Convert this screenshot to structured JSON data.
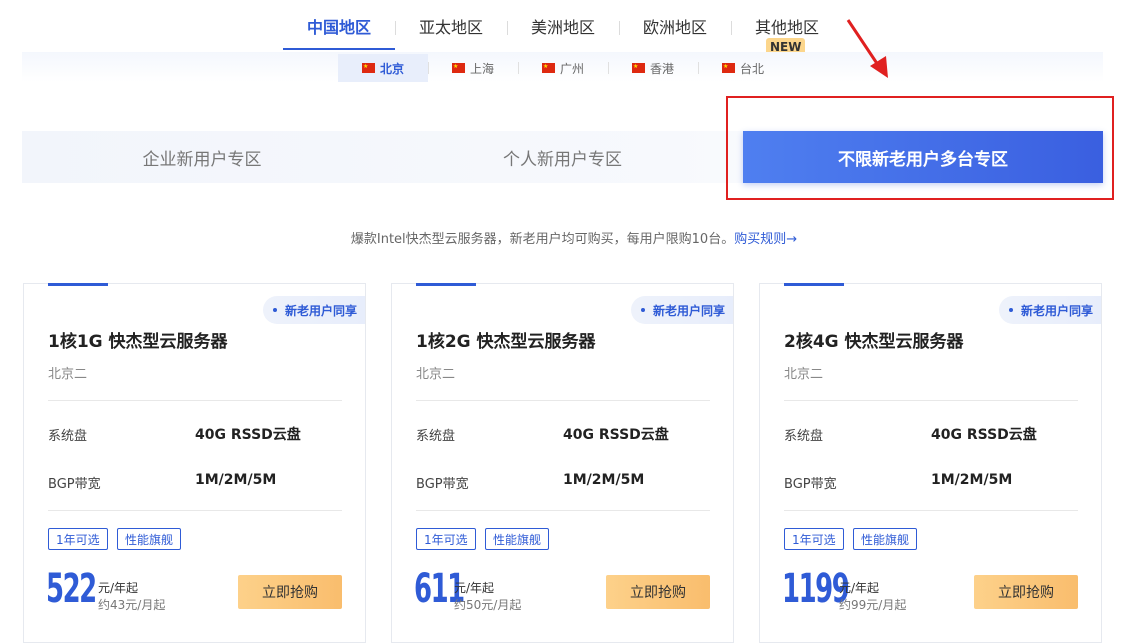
{
  "regions": [
    {
      "label": "中国地区",
      "active": true
    },
    {
      "label": "亚太地区",
      "active": false
    },
    {
      "label": "美洲地区",
      "active": false
    },
    {
      "label": "欧洲地区",
      "active": false
    },
    {
      "label": "其他地区",
      "active": false
    }
  ],
  "new_badge": "NEW",
  "cities": [
    {
      "label": "北京",
      "active": true
    },
    {
      "label": "上海",
      "active": false
    },
    {
      "label": "广州",
      "active": false
    },
    {
      "label": "香港",
      "active": false
    },
    {
      "label": "台北",
      "active": false
    }
  ],
  "zones": [
    {
      "label": "企业新用户专区",
      "active": false
    },
    {
      "label": "个人新用户专区",
      "active": false
    },
    {
      "label": "不限新老用户多台专区",
      "active": true
    }
  ],
  "notice": {
    "text": "爆款Intel快杰型云服务器，新老用户均可购买，每用户限购10台。",
    "link": "购买规则→"
  },
  "cards": [
    {
      "badge": "新老用户同享",
      "title": "1核1G 快杰型云服务器",
      "zone": "北京二",
      "specs": [
        {
          "label": "系统盘",
          "value": "40G RSSD云盘"
        },
        {
          "label": "BGP带宽",
          "value": "1M/2M/5M"
        }
      ],
      "tags": [
        "1年可选",
        "性能旗舰"
      ],
      "price": "522",
      "unit": "元/年起",
      "monthly": "约43元/月起",
      "button": "立即抢购"
    },
    {
      "badge": "新老用户同享",
      "title": "1核2G 快杰型云服务器",
      "zone": "北京二",
      "specs": [
        {
          "label": "系统盘",
          "value": "40G RSSD云盘"
        },
        {
          "label": "BGP带宽",
          "value": "1M/2M/5M"
        }
      ],
      "tags": [
        "1年可选",
        "性能旗舰"
      ],
      "price": "611",
      "unit": "元/年起",
      "monthly": "约50元/月起",
      "button": "立即抢购"
    },
    {
      "badge": "新老用户同享",
      "title": "2核4G 快杰型云服务器",
      "zone": "北京二",
      "specs": [
        {
          "label": "系统盘",
          "value": "40G RSSD云盘"
        },
        {
          "label": "BGP带宽",
          "value": "1M/2M/5M"
        }
      ],
      "tags": [
        "1年可选",
        "性能旗舰"
      ],
      "price": "1199",
      "unit": "元/年起",
      "monthly": "约99元/月起",
      "button": "立即抢购"
    }
  ],
  "colors": {
    "accent": "#2f5bd6",
    "highlight_box": "#e02020",
    "buy_button": "#f9bd6d"
  }
}
